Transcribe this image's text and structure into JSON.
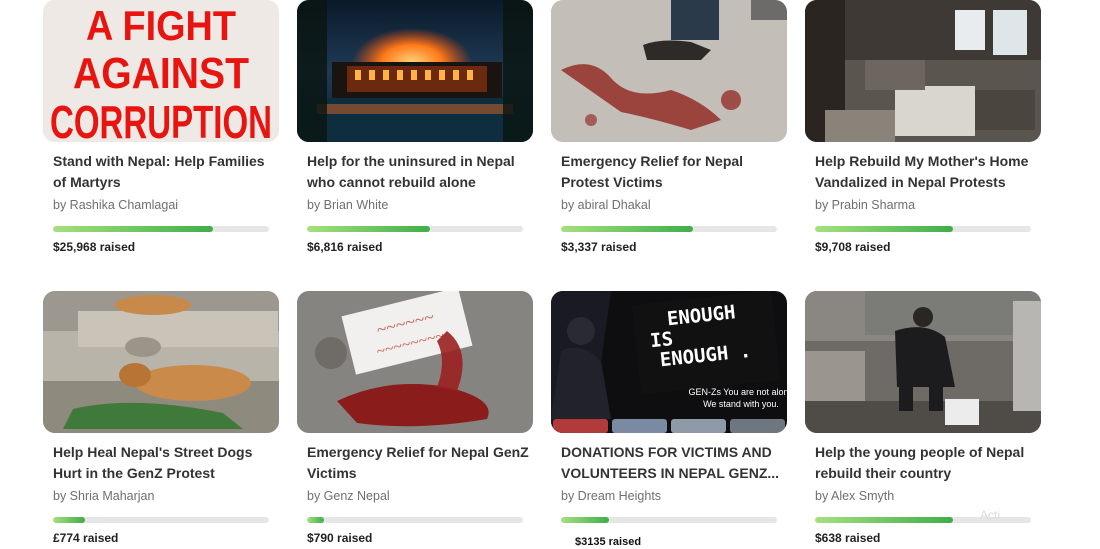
{
  "campaigns": [
    {
      "title": "Stand with Nepal: Help Families of Martyrs",
      "author": "by Rashika Chamlagai",
      "raised": "$25,968 raised",
      "progress": 0.74,
      "image_text": [
        "A FIGHT",
        "AGAINST",
        "CORRUPTION"
      ]
    },
    {
      "title": "Help for the uninsured in Nepal who cannot rebuild alone",
      "author": "by Brian White",
      "raised": "$6,816 raised",
      "progress": 0.57
    },
    {
      "title": "Emergency Relief for Nepal Protest Victims",
      "author": "by abiral Dhakal",
      "raised": "$3,337 raised",
      "progress": 0.61
    },
    {
      "title": "Help Rebuild My Mother's Home Vandalized in Nepal Protests",
      "author": "by Prabin Sharma",
      "raised": "$9,708 raised",
      "progress": 0.64
    },
    {
      "title": "Help Heal Nepal's Street Dogs Hurt in the GenZ Protest",
      "author": "by Shria Maharjan",
      "raised": "£774 raised",
      "progress": 0.15
    },
    {
      "title": "Emergency Relief for Nepal GenZ Victims",
      "author": "by Genz Nepal",
      "raised": "$790 raised",
      "progress": 0.08
    },
    {
      "title": "DONATIONS FOR VICTIMS AND VOLUNTEERS IN NEPAL GENZ...",
      "author": "by Dream Heights",
      "raised": "$3135  raised",
      "progress": 0.22,
      "image_text": [
        "ENOUGH",
        "IS",
        "ENOUGH .",
        "GEN-Zs You are not alone",
        "We stand with you."
      ]
    },
    {
      "title": "Help the young people of Nepal rebuild their country",
      "author": "by Alex Smyth",
      "raised": "$638 raised",
      "progress": 0.64
    }
  ],
  "watermark": "Acti"
}
